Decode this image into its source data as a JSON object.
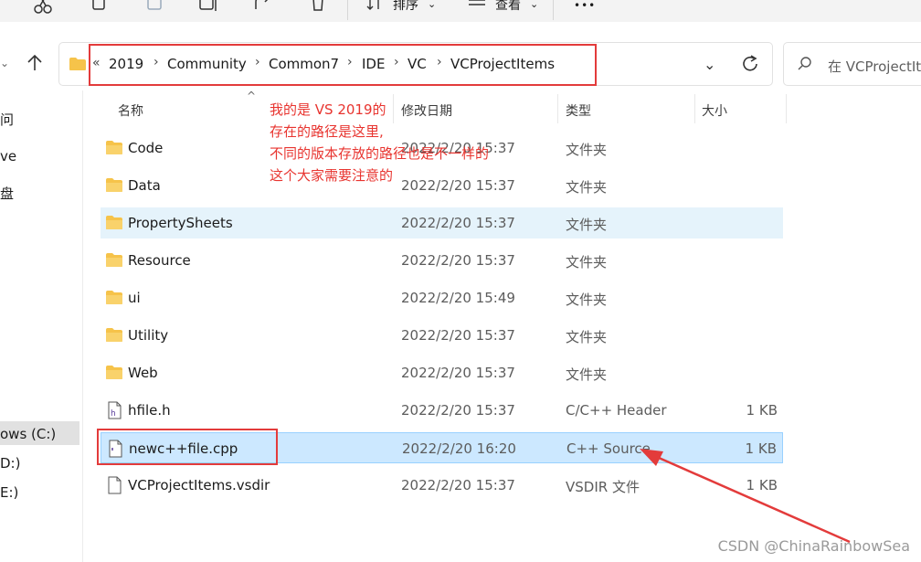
{
  "toolbar": {
    "icons": [
      "cut-icon",
      "copy-icon",
      "paste-icon",
      "rename-icon",
      "share-icon",
      "delete-icon"
    ],
    "sort_label": "排序",
    "view_label": "查看",
    "more_label": "•••"
  },
  "breadcrumb": {
    "overflow": "«",
    "items": [
      "2019",
      "Community",
      "Common7",
      "IDE",
      "VC",
      "VCProjectItems"
    ]
  },
  "search": {
    "placeholder": "在 VCProjectIt"
  },
  "nav": {
    "items": [
      {
        "label": "问"
      },
      {
        "label": "ve"
      },
      {
        "label": "盘"
      },
      {
        "label": "ows (C:)"
      },
      {
        "label": "D:)"
      },
      {
        "label": "E:)"
      }
    ]
  },
  "columns": {
    "name": "名称",
    "date": "修改日期",
    "type": "类型",
    "size": "大小"
  },
  "files": [
    {
      "name": "Code",
      "date": "2022/2/20 15:37",
      "type": "文件夹",
      "size": "",
      "kind": "folder"
    },
    {
      "name": "Data",
      "date": "2022/2/20 15:37",
      "type": "文件夹",
      "size": "",
      "kind": "folder"
    },
    {
      "name": "PropertySheets",
      "date": "2022/2/20 15:37",
      "type": "文件夹",
      "size": "",
      "kind": "folder"
    },
    {
      "name": "Resource",
      "date": "2022/2/20 15:37",
      "type": "文件夹",
      "size": "",
      "kind": "folder"
    },
    {
      "name": "ui",
      "date": "2022/2/20 15:49",
      "type": "文件夹",
      "size": "",
      "kind": "folder"
    },
    {
      "name": "Utility",
      "date": "2022/2/20 15:37",
      "type": "文件夹",
      "size": "",
      "kind": "folder"
    },
    {
      "name": "Web",
      "date": "2022/2/20 15:37",
      "type": "文件夹",
      "size": "",
      "kind": "folder"
    },
    {
      "name": "hfile.h",
      "date": "2022/2/20 15:37",
      "type": "C/C++ Header",
      "size": "1 KB",
      "kind": "header"
    },
    {
      "name": "newc++file.cpp",
      "date": "2022/2/20 16:20",
      "type": "C++ Source",
      "size": "1 KB",
      "kind": "cpp"
    },
    {
      "name": "VCProjectItems.vsdir",
      "date": "2022/2/20 15:37",
      "type": "VSDIR 文件",
      "size": "1 KB",
      "kind": "file"
    }
  ],
  "annotation": {
    "lines": [
      "我的是 VS 2019的",
      "存在的路径是这里,",
      "不同的版本存放的路径也是不一样的",
      "这个大家需要注意的"
    ]
  },
  "watermark": "CSDN @ChinaRainbowSea",
  "colors": {
    "annotation_red": "#e8342f",
    "selection": "#cce8ff",
    "hover": "#e5f3fb",
    "folder": "#f6c34a"
  }
}
